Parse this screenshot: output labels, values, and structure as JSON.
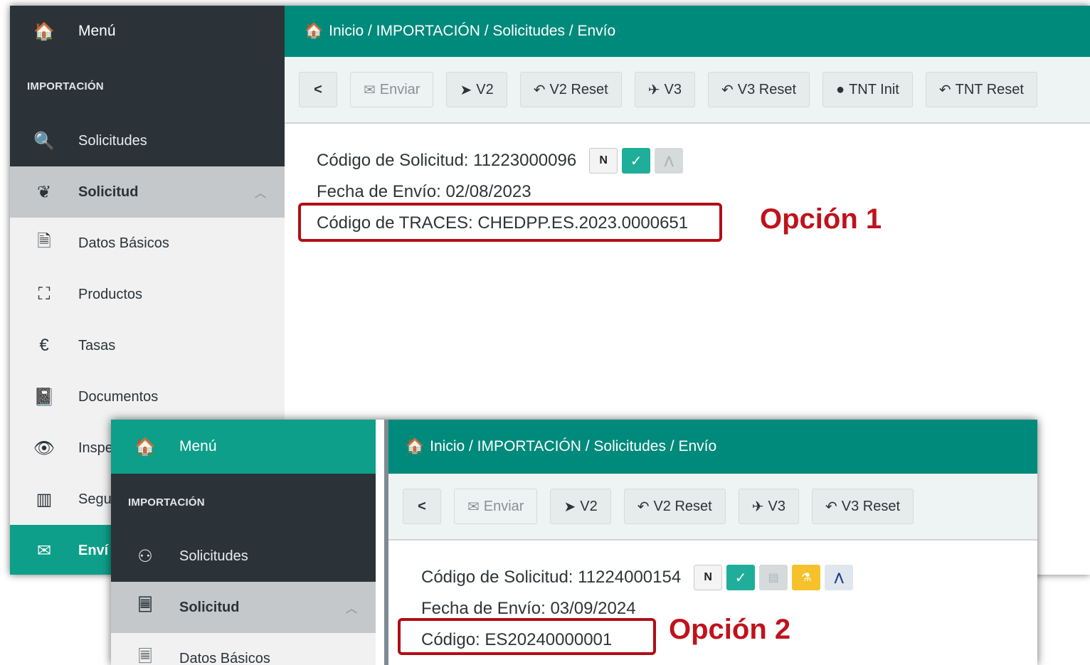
{
  "screen1": {
    "sidebar": {
      "menu": "Menú",
      "section": "IMPORTACIÓN",
      "items": [
        {
          "label": "Solicitudes",
          "icon": "search-icon",
          "glyph": "🔍"
        },
        {
          "label": "Solicitud",
          "icon": "leaf-icon",
          "glyph": "❦"
        },
        {
          "label": "Datos Básicos",
          "icon": "file-icon",
          "glyph": "🗎"
        },
        {
          "label": "Productos",
          "icon": "cubes-icon",
          "glyph": "⛶"
        },
        {
          "label": "Tasas",
          "icon": "euro-icon",
          "glyph": "€"
        },
        {
          "label": "Documentos",
          "icon": "book-icon",
          "glyph": "📓"
        },
        {
          "label": "Inspe",
          "icon": "eye-icon",
          "glyph": "👁"
        },
        {
          "label": "Segu",
          "icon": "map-icon",
          "glyph": "▥"
        },
        {
          "label": "Enví",
          "icon": "envelope-icon",
          "glyph": "✉"
        }
      ]
    },
    "breadcrumb": "Inicio / IMPORTACIÓN / Solicitudes / Envío",
    "toolbar": [
      "Enviar",
      "V2",
      "V2 Reset",
      "V3",
      "V3 Reset",
      "TNT Init",
      "TNT Reset"
    ],
    "codigo_solicitud": "Código de Solicitud: 11223000096",
    "fecha_envio": "Fecha de Envío: 02/08/2023",
    "codigo_traces": "Código de TRACES: CHEDPP.ES.2023.0000651",
    "badge_n": "N"
  },
  "screen2": {
    "sidebar": {
      "menu": "Menú",
      "section": "IMPORTACIÓN",
      "items": [
        {
          "label": "Solicitudes",
          "icon": "award-icon",
          "glyph": "⚇"
        },
        {
          "label": "Solicitud",
          "icon": "list-doc-icon",
          "glyph": "🗏"
        },
        {
          "label": "Datos Básicos",
          "icon": "list-doc-icon",
          "glyph": "🗏"
        }
      ]
    },
    "breadcrumb": "Inicio / IMPORTACIÓN / Solicitudes / Envío",
    "toolbar": [
      "Enviar",
      "V2",
      "V2 Reset",
      "V3",
      "V3 Reset"
    ],
    "codigo_solicitud": "Código de Solicitud: 11224000154",
    "fecha_envio": "Fecha de Envío: 03/09/2024",
    "codigo": "Código: ES20240000001",
    "badge_n": "N"
  },
  "annotations": {
    "option1": "Opción 1",
    "option2": "Opción 2",
    "color": "#c0121c"
  }
}
